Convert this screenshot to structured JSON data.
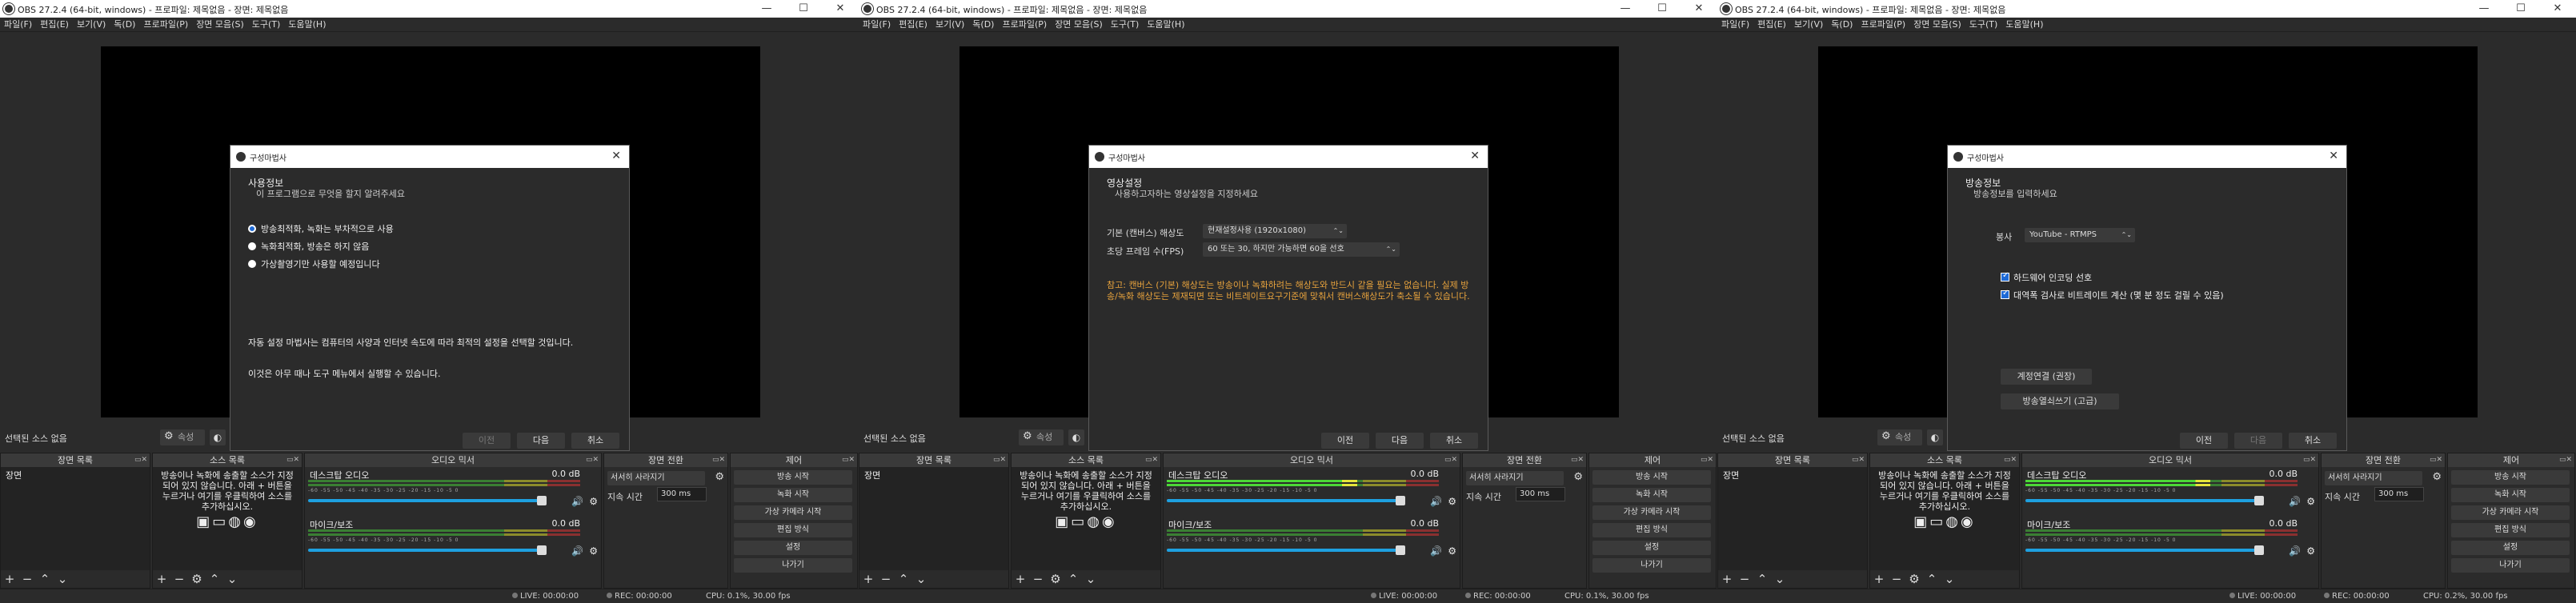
{
  "windows": [
    {
      "title": "OBS 27.2.4 (64-bit, windows) - 프로파일: 제목없음 - 장면: 제목없음",
      "menu": [
        "파일(F)",
        "편집(E)",
        "보기(V)",
        "독(D)",
        "프로파일(P)",
        "장면 모음(S)",
        "도구(T)",
        "도움말(H)"
      ],
      "wizard": {
        "title": "구성마법사",
        "page_title": "사용정보",
        "page_subtitle": "이 프로그램으로 무엇을 할지 알려주세요",
        "options": [
          "방송최적화, 녹화는 부차적으로 사용",
          "녹화최적화, 방송은 하지 않음",
          "가상촬영기만 사용할 예정입니다"
        ],
        "selected_option": 0,
        "note": "자동 설정 마법사는 컴퓨터의 사양과 인터넷 속도에 따라 최적의 설정을 선택할 것입니다.",
        "note2": "이것은 아무 때나 도구 메뉴에서 실행할 수 있습니다.",
        "buttons": {
          "back": "이전",
          "next": "다음",
          "cancel": "취소"
        }
      }
    },
    {
      "title": "OBS 27.2.4 (64-bit, windows) - 프로파일: 제목없음 - 장면: 제목없음",
      "menu": [
        "파일(F)",
        "편집(E)",
        "보기(V)",
        "독(D)",
        "프로파일(P)",
        "장면 모음(S)",
        "도구(T)",
        "도움말(H)"
      ],
      "wizard": {
        "title": "구성마법사",
        "page_title": "영상설정",
        "page_subtitle": "사용하고자하는 영상설정을 지정하세요",
        "fields": [
          {
            "label": "기본 (캔버스) 해상도",
            "value": "현재설정사용 (1920x1080)"
          },
          {
            "label": "초당 프레임 수(FPS)",
            "value": "60 또는 30, 하지만 가능하면 60을 선호"
          }
        ],
        "warning": "참고: 캔버스 (기본) 해상도는 방송이나 녹화하려는 해상도와 반드시 같을 필요는 없습니다. 실제 방송/녹화 해상도는 제재되면 또는 비트레이트요구기준에 맞춰서 캔버스해상도가 축소될 수 있습니다.",
        "buttons": {
          "back": "이전",
          "next": "다음",
          "cancel": "취소"
        }
      }
    },
    {
      "title": "OBS 27.2.4 (64-bit, windows) - 프로파일: 제목없음 - 장면: 제목없음",
      "menu": [
        "파일(F)",
        "편집(E)",
        "보기(V)",
        "독(D)",
        "프로파일(P)",
        "장면 모음(S)",
        "도구(T)",
        "도움말(H)"
      ],
      "wizard": {
        "title": "구성마법사",
        "page_title": "방송정보",
        "page_subtitle": "방송정보를 입력하세요",
        "service_label": "봉사",
        "service_value": "YouTube - RTMPS",
        "checks": [
          "하드웨어 인코딩 선호",
          "대역폭 검사로 비트레이트 계산 (몇 분 정도 걸릴 수 있음)"
        ],
        "connect_account": "계정연결 (권장)",
        "use_stream_key": "방송열쇠쓰기 (고급)",
        "buttons": {
          "back": "이전",
          "next": "다음",
          "cancel": "취소"
        }
      }
    }
  ],
  "main": {
    "no_source": "선택된 소스 없음",
    "properties": "속성",
    "docks": {
      "scenes": "장면 목록",
      "sources": "소스 목록",
      "mixer": "오디오 믹서",
      "transitions": "장면 전환",
      "controls": "제어"
    },
    "scene_item": "장면",
    "sources_empty": "방송이나 녹화에 송출할 소스가 지정되어 있지 않습니다. 아래 + 버튼을 누르거나 여기를 우클릭하여 소스를 추가하십시오.",
    "mixer_channels": [
      {
        "name": "데스크탑 오디오",
        "db": "0.0 dB"
      },
      {
        "name": "마이크/보조",
        "db": "0.0 dB"
      }
    ],
    "transition_value": "서서히 사라지기",
    "duration_label": "지속 시간",
    "duration_value": "300 ms",
    "controls": [
      "방송 시작",
      "녹화 시작",
      "가상 카메라 시작",
      "편집 방식",
      "설정",
      "나가기"
    ],
    "meter_ticks": "-60 -55 -50 -45 -40 -35 -30 -25 -20 -15 -10 -5 0"
  },
  "status": {
    "live": "LIVE: 00:00:00",
    "rec": "REC: 00:00:00",
    "cpu": [
      "CPU: 0.1%, 30.00 fps",
      "CPU: 0.1%, 30.00 fps",
      "CPU: 0.2%, 30.00 fps"
    ]
  }
}
